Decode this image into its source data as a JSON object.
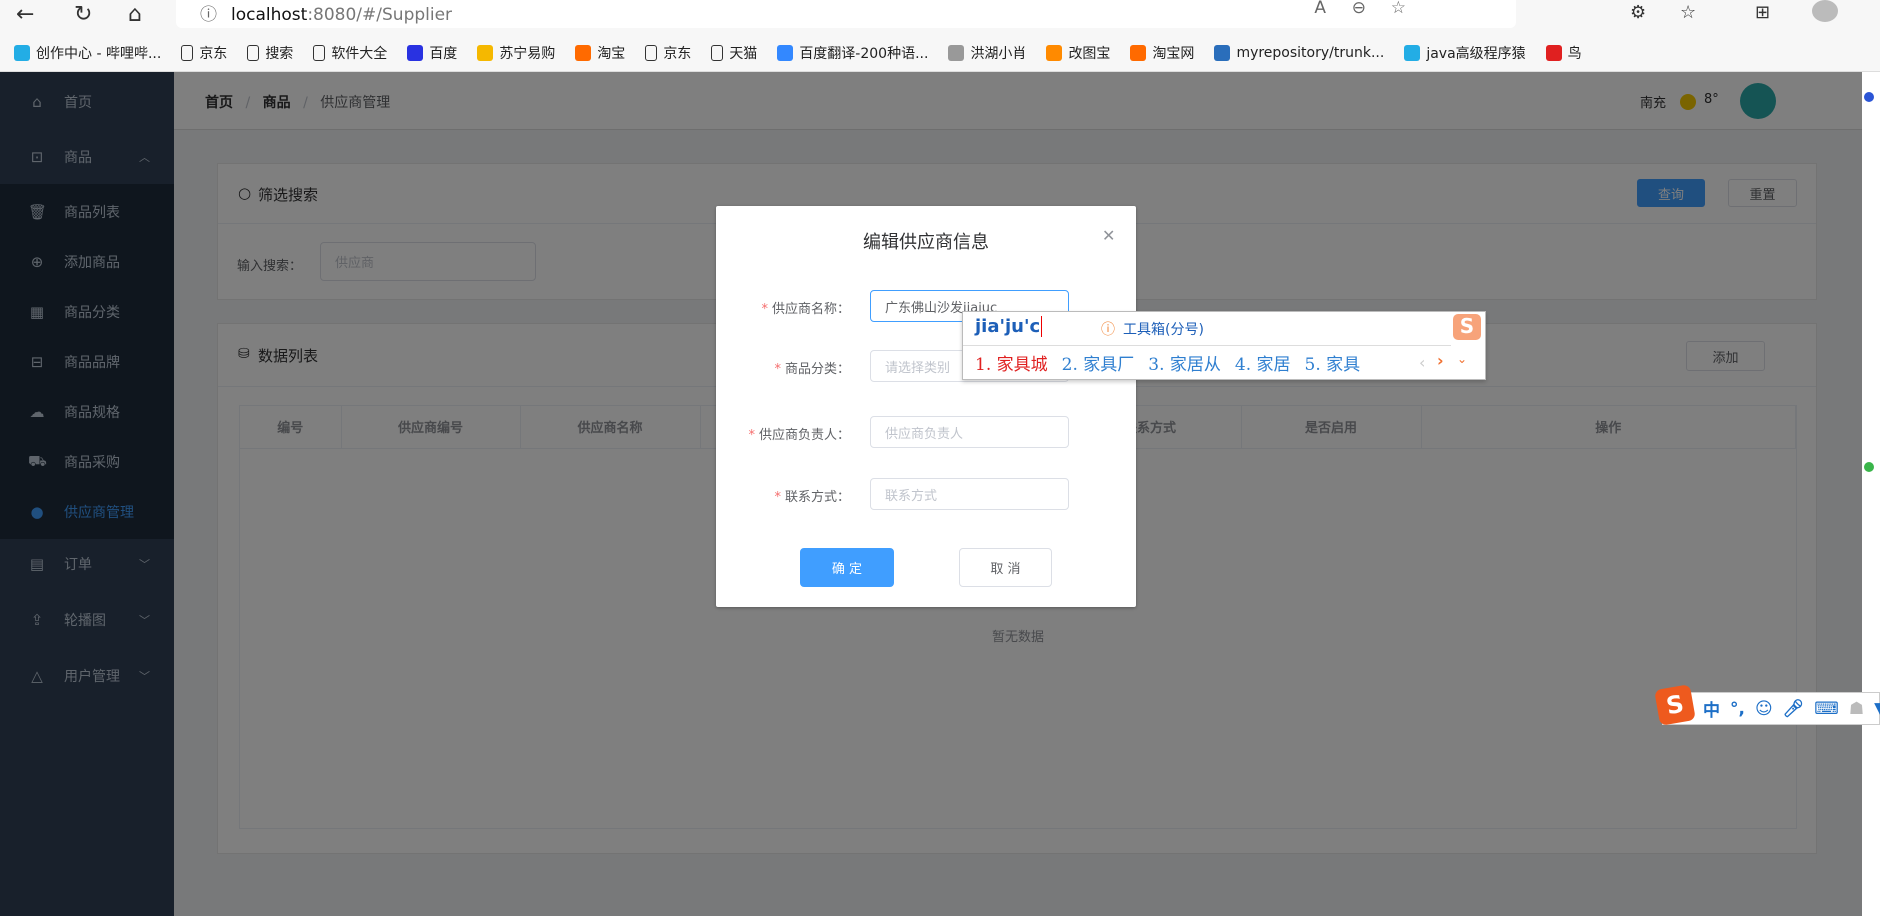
{
  "browser": {
    "url_host": "localhost",
    "url_rest": ":8080/#/Supplier",
    "bookmarks": [
      {
        "label": "创作中心 - 哔哩哔...",
        "icon": "bilibili-icon",
        "color": "#23ade5"
      },
      {
        "label": "京东",
        "icon": "page-icon",
        "color": ""
      },
      {
        "label": "搜索",
        "icon": "page-icon",
        "color": ""
      },
      {
        "label": "软件大全",
        "icon": "page-icon",
        "color": ""
      },
      {
        "label": "百度",
        "icon": "baidu-icon",
        "color": "#2932e1"
      },
      {
        "label": "苏宁易购",
        "icon": "suning-icon",
        "color": "#f5b800"
      },
      {
        "label": "淘宝",
        "icon": "taobao-icon",
        "color": "#ff6a00"
      },
      {
        "label": "京东",
        "icon": "page-icon",
        "color": ""
      },
      {
        "label": "天猫",
        "icon": "page-icon",
        "color": ""
      },
      {
        "label": "百度翻译-200种语...",
        "icon": "translate-icon",
        "color": "#3388ff"
      },
      {
        "label": "洪湖小肖",
        "icon": "bird-icon",
        "color": "#999999"
      },
      {
        "label": "改图宝",
        "icon": "gaitubao-icon",
        "color": "#ff8a00"
      },
      {
        "label": "淘宝网",
        "icon": "taobao-icon",
        "color": "#ff6a00"
      },
      {
        "label": "myrepository/trunk...",
        "icon": "svn-icon",
        "color": "#2a6ebb"
      },
      {
        "label": "java高级程序猿",
        "icon": "bilibili-icon",
        "color": "#23ade5"
      },
      {
        "label": "鸟",
        "icon": "bird-red-icon",
        "color": "#e02020"
      }
    ]
  },
  "sidebar": {
    "items": [
      {
        "label": "首页",
        "icon": "home-icon"
      },
      {
        "label": "商品",
        "icon": "bag-icon",
        "chevron": "︿"
      },
      {
        "label": "商品列表",
        "icon": "trash-icon"
      },
      {
        "label": "添加商品",
        "icon": "plus-circle-icon"
      },
      {
        "label": "商品分类",
        "icon": "grid-icon"
      },
      {
        "label": "商品品牌",
        "icon": "badge-icon"
      },
      {
        "label": "商品规格",
        "icon": "cloud-icon"
      },
      {
        "label": "商品采购",
        "icon": "truck-icon"
      },
      {
        "label": "供应商管理",
        "icon": "user-icon"
      },
      {
        "label": "订单",
        "icon": "clipboard-icon",
        "chevron": "﹀"
      },
      {
        "label": "轮播图",
        "icon": "upload-icon",
        "chevron": "﹀"
      },
      {
        "label": "用户管理",
        "icon": "bell-icon",
        "chevron": "﹀"
      }
    ]
  },
  "header": {
    "breadcrumb": [
      "首页",
      "商品",
      "供应商管理"
    ],
    "separator": "/",
    "city": "南充",
    "temperature": "8°"
  },
  "filter": {
    "title": "筛选搜索",
    "query": "查询",
    "reset": "重置",
    "label": "输入搜索：",
    "placeholder": "供应商"
  },
  "list": {
    "title": "数据列表",
    "add": "添加",
    "columns": [
      "编号",
      "供应商编号",
      "供应商名称",
      "",
      "",
      "联系方式",
      "是否启用",
      "操作"
    ],
    "empty": "暂无数据"
  },
  "dialog": {
    "title": "编辑供应商信息",
    "fields": [
      {
        "label": "供应商名称：",
        "value": "广东佛山沙发jiajuc",
        "placeholder": ""
      },
      {
        "label": "商品分类：",
        "value": "",
        "placeholder": "请选择类别"
      },
      {
        "label": "供应商负责人：",
        "value": "",
        "placeholder": "供应商负责人"
      },
      {
        "label": "联系方式：",
        "value": "",
        "placeholder": "联系方式"
      }
    ],
    "confirm": "确 定",
    "cancel": "取 消"
  },
  "ime": {
    "pinyin": "jia'ju'c",
    "toolbox": "工具箱(分号)",
    "candidates": [
      "1. 家具城",
      "2. 家具厂",
      "3. 家居从",
      "4. 家居",
      "5. 家具"
    ],
    "mode": "中",
    "punct": "°,"
  }
}
